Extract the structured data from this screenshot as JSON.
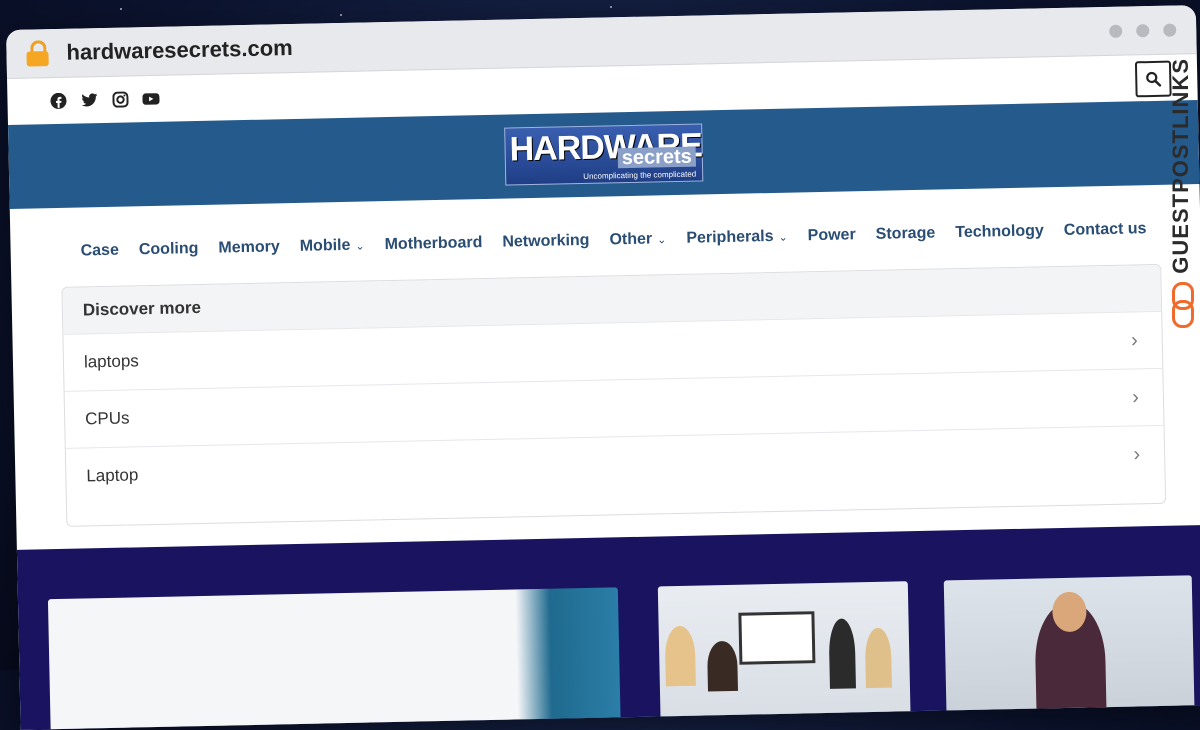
{
  "browser": {
    "url": "hardwaresecrets.com"
  },
  "social": [
    "facebook-icon",
    "twitter-icon",
    "instagram-icon",
    "youtube-icon"
  ],
  "logo": {
    "main": "HARDWARE",
    "secondary": "secrets",
    "tagline": "Uncomplicating the complicated"
  },
  "nav": [
    {
      "label": "Case",
      "dropdown": false
    },
    {
      "label": "Cooling",
      "dropdown": false
    },
    {
      "label": "Memory",
      "dropdown": false
    },
    {
      "label": "Mobile",
      "dropdown": true
    },
    {
      "label": "Motherboard",
      "dropdown": false
    },
    {
      "label": "Networking",
      "dropdown": false
    },
    {
      "label": "Other",
      "dropdown": true
    },
    {
      "label": "Peripherals",
      "dropdown": true
    },
    {
      "label": "Power",
      "dropdown": false
    },
    {
      "label": "Storage",
      "dropdown": false
    },
    {
      "label": "Technology",
      "dropdown": false
    },
    {
      "label": "Contact us",
      "dropdown": false
    }
  ],
  "discover": {
    "title": "Discover more",
    "items": [
      "laptops",
      "CPUs",
      "Laptop"
    ]
  },
  "watermark": "GUESTPOSTLINKS",
  "colors": {
    "banner": "#255a8c",
    "nav_text": "#2a4d74",
    "dark_section": "#1a1460",
    "watermark_accent": "#f06a2b"
  }
}
